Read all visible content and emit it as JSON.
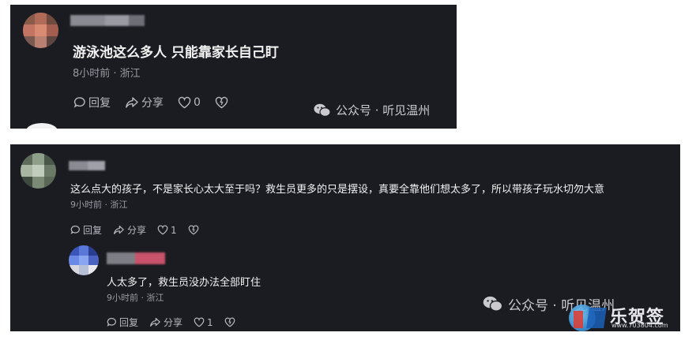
{
  "comments": [
    {
      "text": "游泳池这么多人  只能靠家长自己盯",
      "meta": "8小时前 · 浙江",
      "actions": {
        "reply": "回复",
        "share": "分享",
        "like_count": "0"
      }
    },
    {
      "text": "这么点大的孩子，不是家长心太大至于吗？救生员更多的只是摆设，真要全靠他们想太多了，所以带孩子玩水切勿大意",
      "meta": "9小时前 · 浙江",
      "actions": {
        "reply": "回复",
        "share": "分享",
        "like_count": "1"
      },
      "reply": {
        "text": "人太多了，救生员没办法全部盯住",
        "meta": "9小时前 · 浙江",
        "actions": {
          "reply": "回复",
          "share": "分享",
          "like_count": "1"
        }
      }
    }
  ],
  "watermark_top": "公众号 · 听见温州",
  "watermark_bottom": "公众号 · 听见温州",
  "site_logo": {
    "brand": "乐贺签",
    "url": "www.703804.com"
  },
  "icons": [
    "comment-icon",
    "share-icon",
    "heart-icon",
    "dislike-heart-icon",
    "wechat-icon"
  ],
  "colors": {
    "panel_bg": "#1b1b22",
    "text": "#f2f2f2",
    "meta": "#9a9aa2",
    "page_bg": "#ffffff"
  }
}
